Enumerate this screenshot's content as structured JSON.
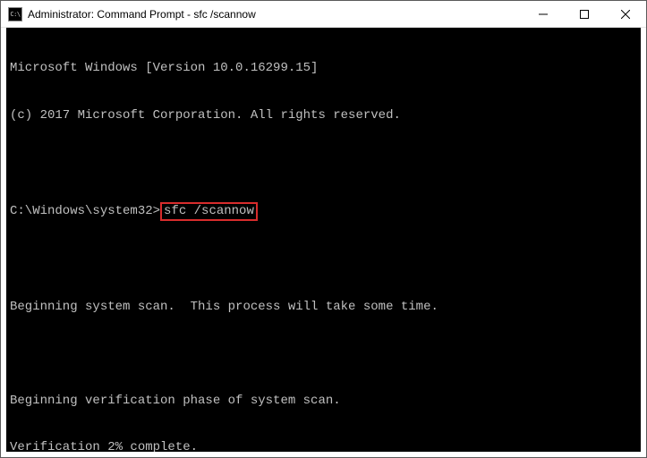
{
  "window": {
    "title": "Administrator: Command Prompt - sfc  /scannow",
    "icon_label": "C:\\"
  },
  "console": {
    "line1": "Microsoft Windows [Version 10.0.16299.15]",
    "line2": "(c) 2017 Microsoft Corporation. All rights reserved.",
    "blank1": " ",
    "prompt": "C:\\Windows\\system32>",
    "command": "sfc /scannow",
    "blank2": " ",
    "line3": "Beginning system scan.  This process will take some time.",
    "blank3": " ",
    "line4": "Beginning verification phase of system scan.",
    "line5": "Verification 2% complete."
  }
}
